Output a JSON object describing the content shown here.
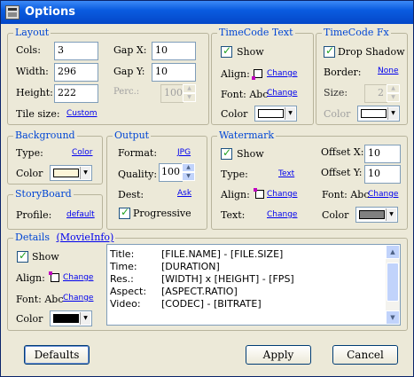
{
  "window": {
    "title": "Options"
  },
  "layout": {
    "legend": "Layout",
    "cols_label": "Cols:",
    "cols_value": "3",
    "width_label": "Width:",
    "width_value": "296",
    "height_label": "Height:",
    "height_value": "222",
    "tilesize_label": "Tile size:",
    "tilesize_link": "Custom",
    "gapx_label": "Gap X:",
    "gapx_value": "10",
    "gapy_label": "Gap Y:",
    "gapy_value": "10",
    "perc_label": "Perc.:",
    "perc_value": "100"
  },
  "timecode_text": {
    "legend": "TimeCode Text",
    "show_label": "Show",
    "show_checked": true,
    "align_label": "Align:",
    "align_link": "Change",
    "font_label": "Font: Abc",
    "font_link": "Change",
    "color_label": "Color",
    "color_value": "#ffffff"
  },
  "timecode_fx": {
    "legend": "TimeCode Fx",
    "dropshadow_label": "Drop Shadow",
    "dropshadow_checked": true,
    "border_label": "Border:",
    "border_link": "None",
    "size_label": "Size:",
    "size_value": "2",
    "color_label": "Color",
    "color_value": "#ffffff"
  },
  "background": {
    "legend": "Background",
    "type_label": "Type:",
    "type_link": "Color",
    "color_label": "Color",
    "color_value": "#fdf5d8"
  },
  "output": {
    "legend": "Output",
    "format_label": "Format:",
    "format_link": "JPG",
    "quality_label": "Quality:",
    "quality_value": "100",
    "dest_label": "Dest:",
    "dest_link": "Ask",
    "progressive_label": "Progressive",
    "progressive_checked": true
  },
  "watermark": {
    "legend": "Watermark",
    "show_label": "Show",
    "show_checked": true,
    "type_label": "Type:",
    "type_link": "Text",
    "align_label": "Align:",
    "align_link": "Change",
    "text_label": "Text:",
    "text_link": "Change",
    "offsetx_label": "Offset X:",
    "offsetx_value": "10",
    "offsety_label": "Offset Y:",
    "offsety_value": "10",
    "font_label": "Font: Abc",
    "font_link": "Change",
    "color_label": "Color",
    "color_value": "#808080"
  },
  "storyboard": {
    "legend": "StoryBoard",
    "profile_label": "Profile:",
    "profile_link": "default"
  },
  "details": {
    "legend": "Details",
    "legend_link": "(MovieInfo)",
    "show_label": "Show",
    "show_checked": true,
    "align_label": "Align:",
    "align_link": "Change",
    "font_label": "Font: Abc",
    "font_link": "Change",
    "color_label": "Color",
    "color_value": "#000000",
    "rows": [
      {
        "key": "Title:",
        "value": "[FILE.NAME] - [FILE.SIZE]"
      },
      {
        "key": "Time:",
        "value": "[DURATION]"
      },
      {
        "key": "Res.:",
        "value": "[WIDTH] x [HEIGHT] - [FPS]"
      },
      {
        "key": "Aspect:",
        "value": "[ASPECT.RATIO]"
      },
      {
        "key": "Video:",
        "value": "[CODEC] - [BITRATE]"
      }
    ]
  },
  "buttons": {
    "defaults": "Defaults",
    "apply": "Apply",
    "cancel": "Cancel"
  }
}
